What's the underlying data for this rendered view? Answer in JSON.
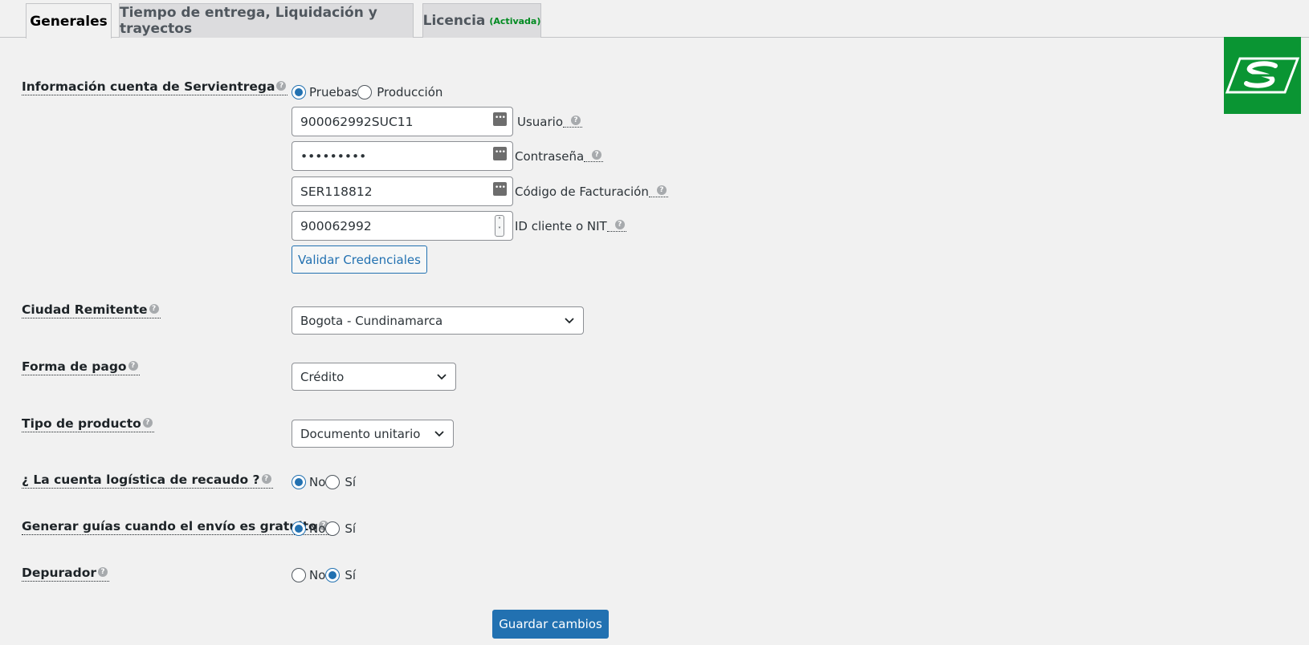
{
  "tabs": [
    {
      "label": "Generales",
      "active": true
    },
    {
      "label": "Tiempo de entrega, Liquidación y trayectos",
      "active": false
    },
    {
      "label": "Licencia",
      "badge": "(Activada)",
      "active": false
    }
  ],
  "colors": {
    "accent": "#2271b1",
    "logo_bg": "#0a9533",
    "badge": "#008a20"
  },
  "account": {
    "label": "Información cuenta de Servientrega",
    "env_options": [
      "Pruebas",
      "Producción"
    ],
    "env_selected": "Pruebas",
    "user_value": "900062992SUC11",
    "user_label": "Usuario",
    "password_value": "•••••••••",
    "password_label": "Contraseña",
    "billing_value": "SER118812",
    "billing_label": "Código de Facturación",
    "nit_value": "900062992",
    "nit_label": "ID cliente o NIT",
    "validate_button": "Validar Credenciales"
  },
  "city": {
    "label": "Ciudad Remitente",
    "value": "Bogota - Cundinamarca"
  },
  "payment": {
    "label": "Forma de pago",
    "value": "Crédito"
  },
  "product": {
    "label": "Tipo de producto",
    "value": "Documento unitario"
  },
  "collection": {
    "label": "¿ La cuenta logística de recaudo ?",
    "no": "No",
    "yes": "Sí",
    "selected": "No"
  },
  "free_shipping": {
    "label": "Generar guías cuando el envío es gratuito",
    "no": "No",
    "yes": "Sí",
    "selected": "No"
  },
  "debugger": {
    "label": "Depurador",
    "no": "No",
    "yes": "Sí",
    "selected": "Sí"
  },
  "save_button": "Guardar cambios",
  "icons": {
    "help": "help-icon",
    "key": "key-icon",
    "chevron": "chevron-down-icon",
    "logo": "servientrega-logo-icon"
  }
}
